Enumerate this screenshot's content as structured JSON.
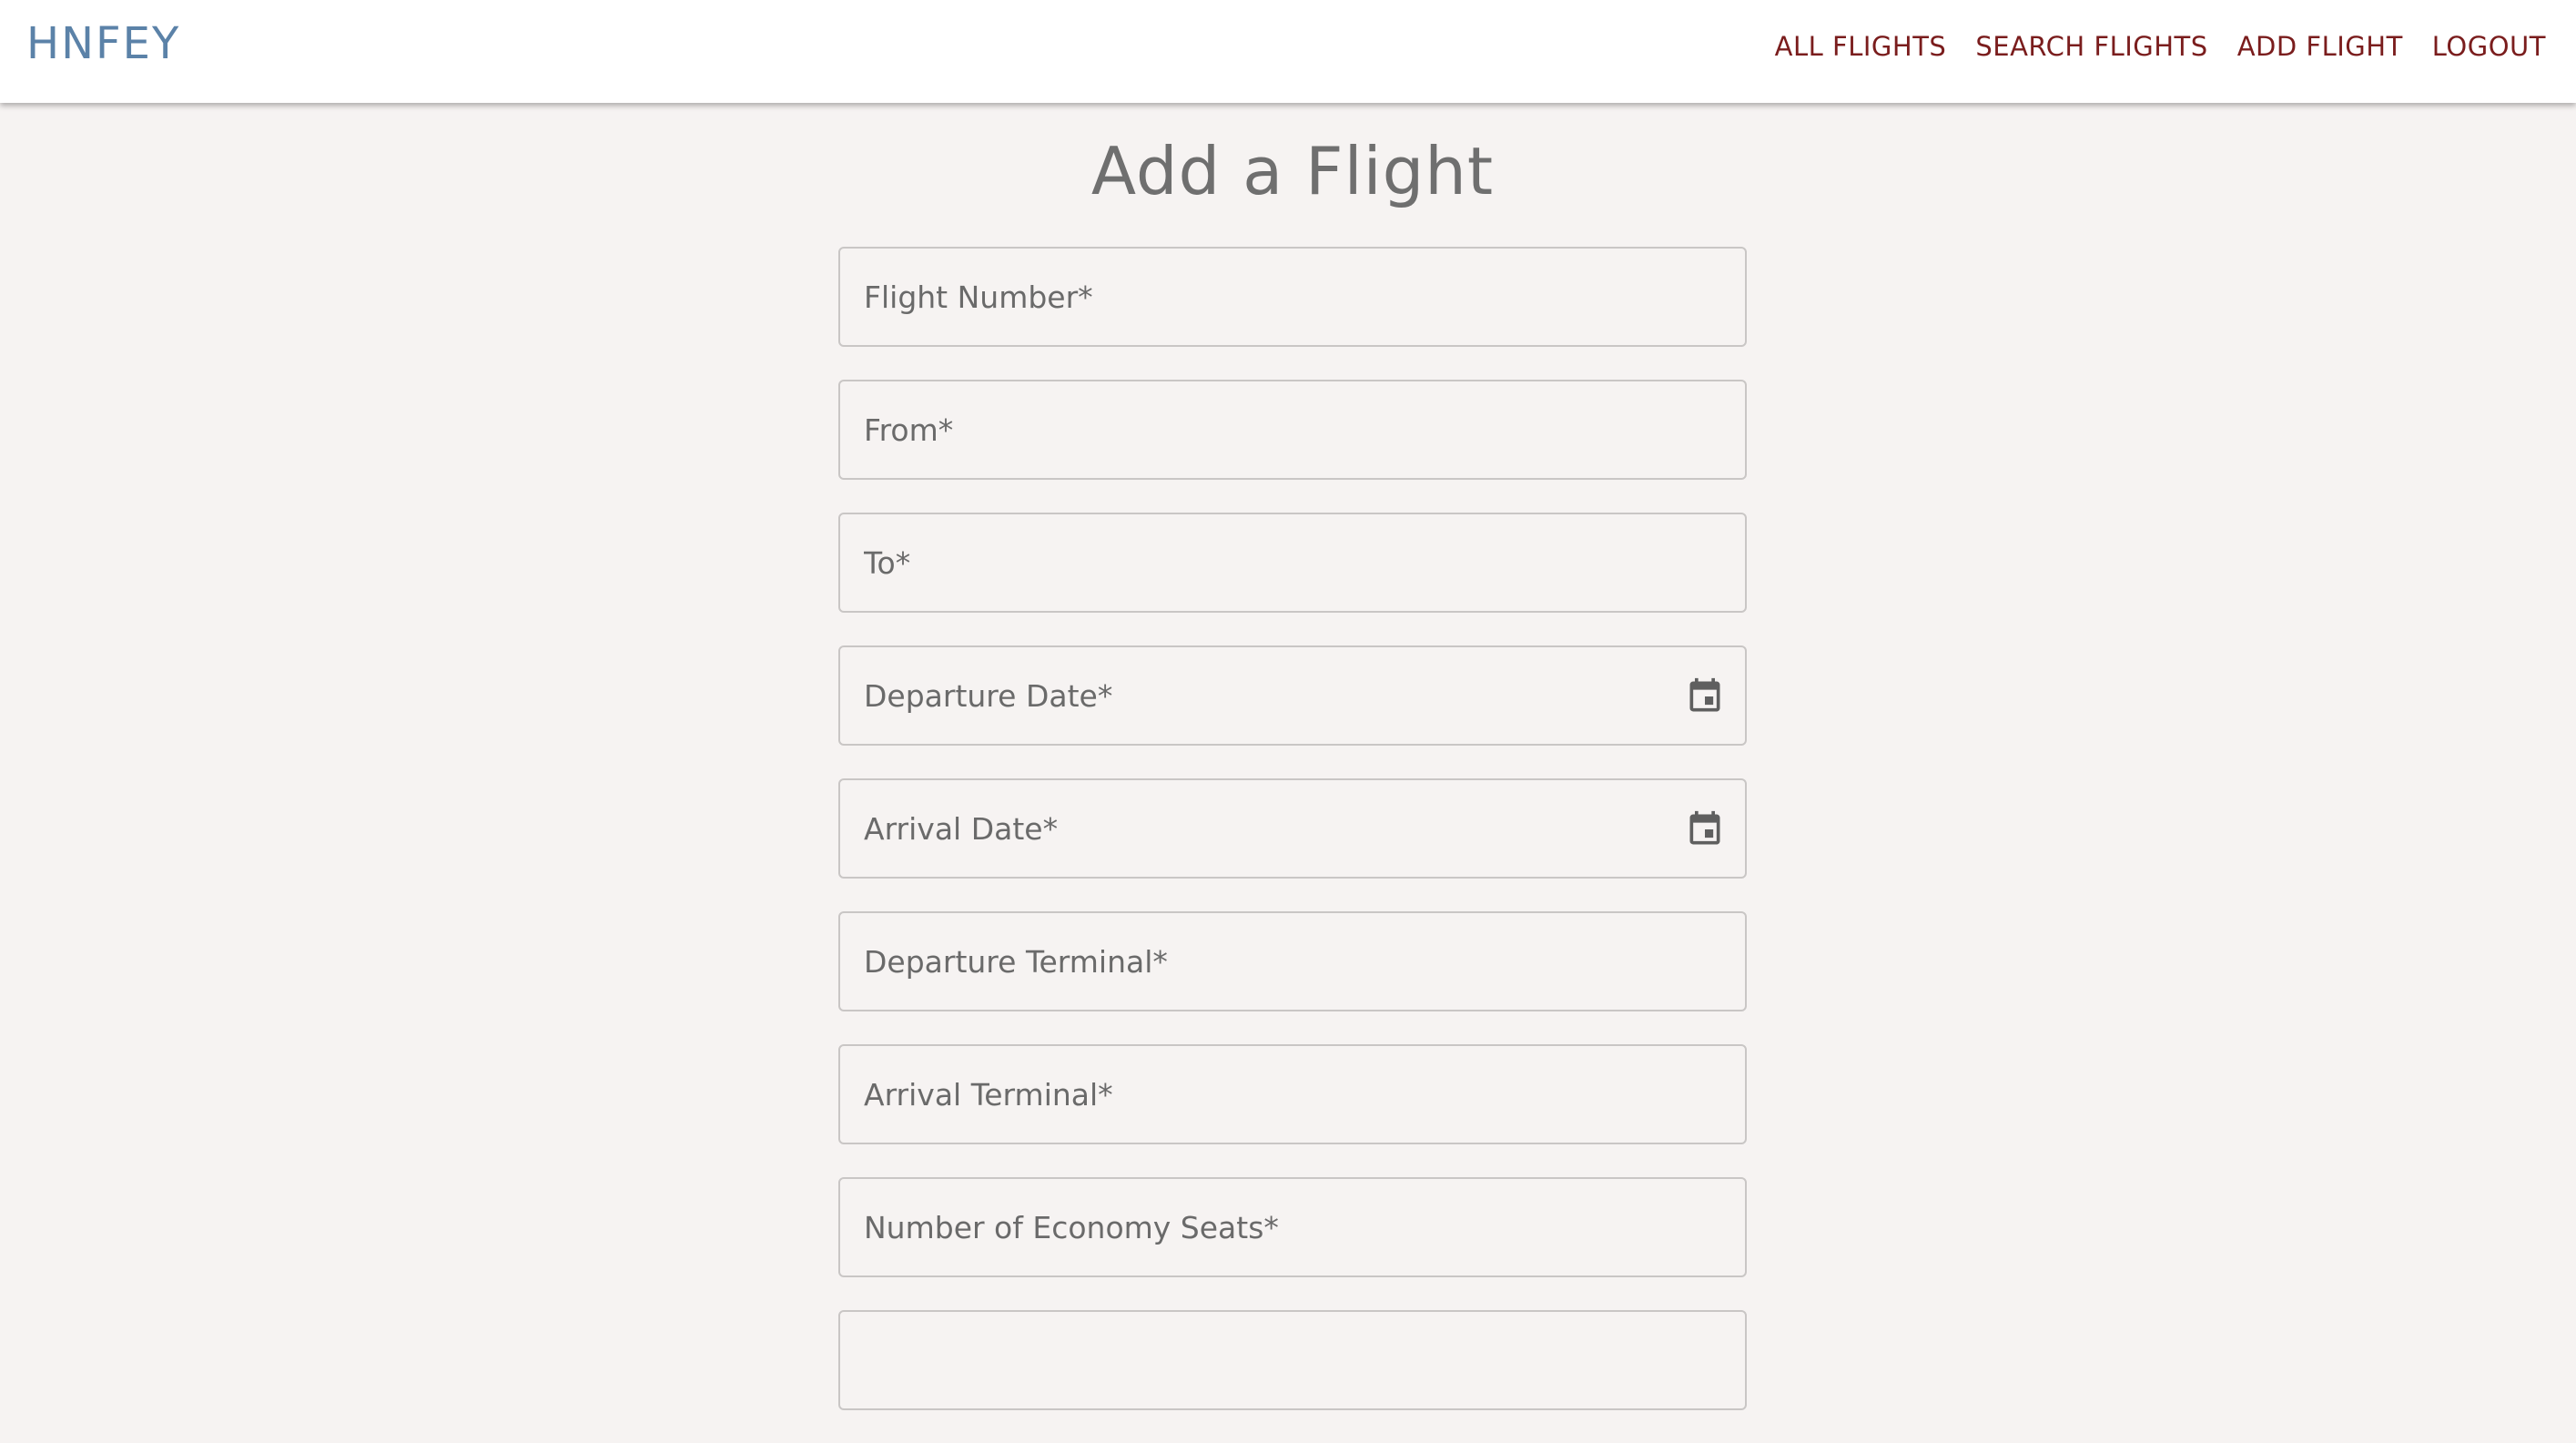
{
  "brand": "HNFEY",
  "nav": {
    "all_flights": "ALL FLIGHTS",
    "search_flights": "SEARCH FLIGHTS",
    "add_flight": "ADD FLIGHT",
    "logout": "LOGOUT"
  },
  "page_title": "Add a Flight",
  "fields": {
    "flight_number": "Flight Number*",
    "from": "From*",
    "to": "To*",
    "departure_date": "Departure Date*",
    "arrival_date": "Arrival Date*",
    "departure_terminal": "Departure Terminal*",
    "arrival_terminal": "Arrival Terminal*",
    "economy_seats": "Number of Economy Seats*"
  },
  "icons": {
    "calendar": "calendar-icon"
  },
  "colors": {
    "brand": "#5b82a8",
    "nav_link": "#7a1d1d",
    "background": "#f6f3f2"
  }
}
